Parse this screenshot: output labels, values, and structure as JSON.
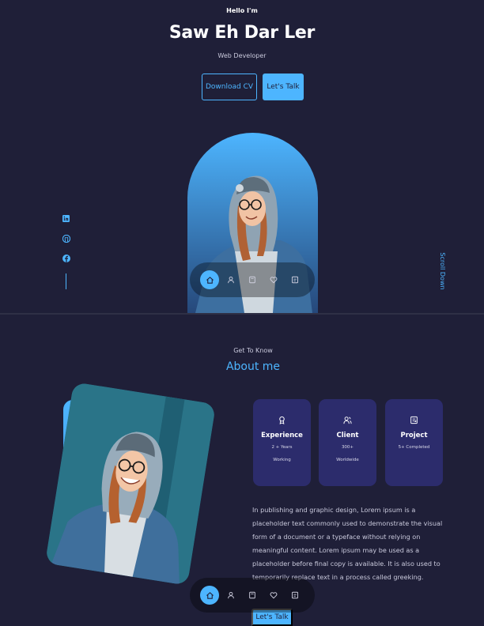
{
  "header": {
    "greeting": "Hello I'm",
    "name": "Saw Eh Dar Ler",
    "role": "Web Developer",
    "download_cv": "Download CV",
    "lets_talk": "Let's Talk"
  },
  "hero": {
    "scroll_label": "Scroll Down"
  },
  "social": [
    {
      "icon": "linkedin-icon"
    },
    {
      "icon": "github-icon"
    },
    {
      "icon": "facebook-icon"
    }
  ],
  "nav": {
    "items": [
      {
        "icon": "home-icon",
        "active": true
      },
      {
        "icon": "user-icon",
        "active": false
      },
      {
        "icon": "book-icon",
        "active": false
      },
      {
        "icon": "services-icon",
        "active": false
      },
      {
        "icon": "message-icon",
        "active": false
      }
    ]
  },
  "about": {
    "eyebrow": "Get To Know",
    "title": "About me",
    "cards": [
      {
        "title": "Experience",
        "line1": "2 + Years",
        "line2": "Working",
        "icon": "award-icon"
      },
      {
        "title": "Client",
        "line1": "300+",
        "line2": "Worldwide",
        "icon": "users-icon"
      },
      {
        "title": "Project",
        "line1": "5+ Completed",
        "line2": "",
        "icon": "folder-icon"
      }
    ],
    "description": "In publishing and graphic design, Lorem ipsum is a placeholder text commonly used to demonstrate the visual form of a document or a typeface without relying on meaningful content. Lorem ipsum may be used as a placeholder before final copy is available. It is also used to temporarily replace text in a process called greeking.",
    "lets_talk": "Let's Talk"
  },
  "colors": {
    "background": "#1f1f38",
    "accent": "#4db5ff",
    "card": "#2c2c6c"
  }
}
